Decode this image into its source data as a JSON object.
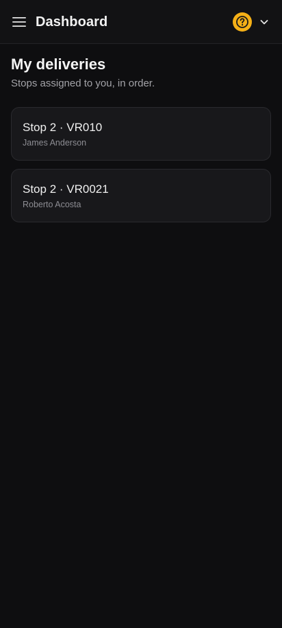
{
  "header": {
    "title": "Dashboard",
    "menu_icon": "hamburger-menu-icon",
    "help_icon": "question-mark-icon",
    "dropdown_icon": "chevron-down-icon",
    "accent_color": "#f5b017"
  },
  "page": {
    "title": "My deliveries",
    "subtitle": "Stops assigned to you, in order."
  },
  "deliveries": [
    {
      "title": "Stop 2 · VR010",
      "customer": "James Anderson"
    },
    {
      "title": "Stop 2 · VR0021",
      "customer": "Roberto Acosta"
    }
  ],
  "colors": {
    "background": "#0e0e10",
    "card_background": "#18181b",
    "card_border": "#2a2a2e",
    "muted_text": "#a3a3a8"
  }
}
